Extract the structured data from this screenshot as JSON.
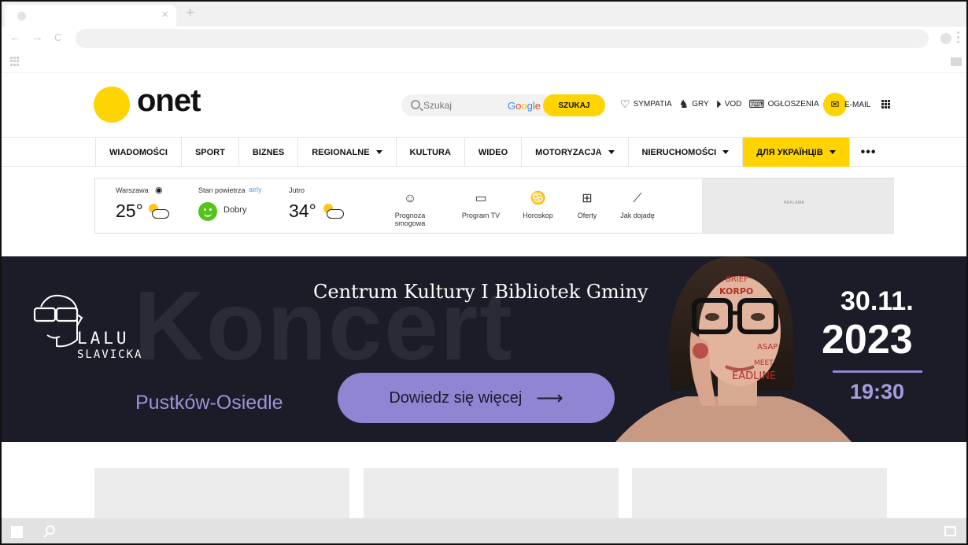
{
  "browser": {
    "tab_close": "×",
    "new_tab": "+",
    "back": "←",
    "forward": "→",
    "reload": "C"
  },
  "header": {
    "logo": "onet",
    "search_placeholder": "Szukaj",
    "google": "Google",
    "search_button": "SZUKAJ",
    "links": [
      {
        "label": "SYMPATIA",
        "icon": "heart-icon"
      },
      {
        "label": "GRY",
        "icon": "chess-icon"
      },
      {
        "label": "VOD",
        "icon": "play-icon"
      },
      {
        "label": "OGŁOSZENIA",
        "icon": "keyboard-icon"
      }
    ],
    "email": "E-MAIL"
  },
  "nav": {
    "items": [
      {
        "label": "WIADOMOŚCI",
        "dropdown": false
      },
      {
        "label": "SPORT",
        "dropdown": false
      },
      {
        "label": "BIZNES",
        "dropdown": false
      },
      {
        "label": "REGIONALNE",
        "dropdown": true
      },
      {
        "label": "KULTURA",
        "dropdown": false
      },
      {
        "label": "WIDEO",
        "dropdown": false
      },
      {
        "label": "MOTORYZACJA",
        "dropdown": true
      },
      {
        "label": "NIERUCHOMOŚCI",
        "dropdown": true
      },
      {
        "label": "ДЛЯ УКРАЇНЦІВ",
        "dropdown": true,
        "highlight": true
      }
    ],
    "more": "•••"
  },
  "widgets": {
    "weather": {
      "city": "Warszawa",
      "temp": "25°"
    },
    "air": {
      "label": "Stan powietrza",
      "provider": "airly",
      "status": "Dobry"
    },
    "tomorrow": {
      "label": "Jutro",
      "temp": "34°"
    },
    "tools": [
      {
        "label": "Prognoza smogowa",
        "icon": "smog-mask-icon"
      },
      {
        "label": "Program TV",
        "icon": "tv-icon"
      },
      {
        "label": "Horoskop",
        "icon": "cancer-zodiac-icon"
      },
      {
        "label": "Oferty",
        "icon": "gift-icon"
      },
      {
        "label": "Jak dojadę",
        "icon": "route-icon"
      }
    ],
    "ad_label": "REKLAMA"
  },
  "banner": {
    "bg_word": "Koncert",
    "title": "Centrum Kultury I Bibliotek Gminy",
    "artist_line1": "LALU",
    "artist_line2": "SLAVICKA",
    "location": "Pustków-Osiedle",
    "cta": "Dowiedz się więcej",
    "cta_arrow": "⟶",
    "date_day": "30.11.",
    "date_year": "2023",
    "time": "19:30",
    "colors": {
      "bg": "#1b1c27",
      "accent": "#8f85d2"
    }
  }
}
